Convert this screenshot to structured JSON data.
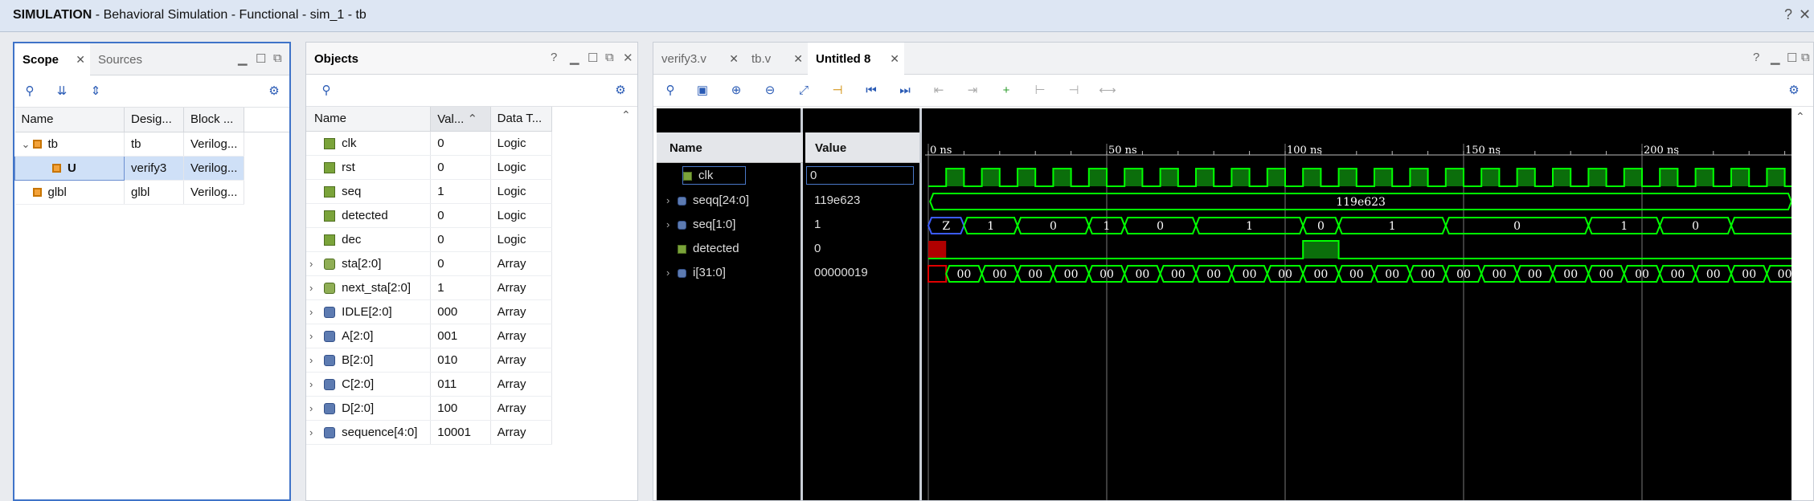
{
  "titlebar": {
    "app": "SIMULATION",
    "subtitle": " - Behavioral Simulation - Functional - sim_1 - tb",
    "help": "?",
    "close": "✕"
  },
  "scope": {
    "tabs": [
      "Scope",
      "Sources"
    ],
    "columns": [
      "Name",
      "Desig...",
      "Block ..."
    ],
    "rows": [
      {
        "name": "tb",
        "design": "tb",
        "block": "Verilog..."
      },
      {
        "name": "U",
        "design": "verify3",
        "block": "Verilog..."
      },
      {
        "name": "glbl",
        "design": "glbl",
        "block": "Verilog..."
      }
    ]
  },
  "objects": {
    "title": "Objects",
    "columns": [
      "Name",
      "Val...",
      "Data T..."
    ],
    "rows": [
      {
        "name": "clk",
        "value": "0",
        "type": "Logic",
        "icon": "logic",
        "expand": ""
      },
      {
        "name": "rst",
        "value": "0",
        "type": "Logic",
        "icon": "logic",
        "expand": ""
      },
      {
        "name": "seq",
        "value": "1",
        "type": "Logic",
        "icon": "logic",
        "expand": ""
      },
      {
        "name": "detected",
        "value": "0",
        "type": "Logic",
        "icon": "logic",
        "expand": ""
      },
      {
        "name": "dec",
        "value": "0",
        "type": "Logic",
        "icon": "logic",
        "expand": ""
      },
      {
        "name": "sta[2:0]",
        "value": "0",
        "type": "Array",
        "icon": "arrg",
        "expand": "›"
      },
      {
        "name": "next_sta[2:0]",
        "value": "1",
        "type": "Array",
        "icon": "arrg",
        "expand": "›"
      },
      {
        "name": "IDLE[2:0]",
        "value": "000",
        "type": "Array",
        "icon": "arr",
        "expand": "›"
      },
      {
        "name": "A[2:0]",
        "value": "001",
        "type": "Array",
        "icon": "arr",
        "expand": "›"
      },
      {
        "name": "B[2:0]",
        "value": "010",
        "type": "Array",
        "icon": "arr",
        "expand": "›"
      },
      {
        "name": "C[2:0]",
        "value": "011",
        "type": "Array",
        "icon": "arr",
        "expand": "›"
      },
      {
        "name": "D[2:0]",
        "value": "100",
        "type": "Array",
        "icon": "arr",
        "expand": "›"
      },
      {
        "name": "sequence[4:0]",
        "value": "10001",
        "type": "Array",
        "icon": "arr",
        "expand": "›"
      }
    ]
  },
  "editor": {
    "tabs": [
      "verify3.v",
      "tb.v",
      "Untitled 8"
    ],
    "active_tab": 2
  },
  "wave": {
    "header": {
      "name": "Name",
      "value": "Value"
    },
    "signals": [
      {
        "name": "clk",
        "value": "0",
        "expand": ""
      },
      {
        "name": "seqq[24:0]",
        "value": "119e623",
        "expand": "›"
      },
      {
        "name": "seq[1:0]",
        "value": "1",
        "expand": "›"
      },
      {
        "name": "detected",
        "value": "0",
        "expand": ""
      },
      {
        "name": "i[31:0]",
        "value": "00000019",
        "expand": "›"
      }
    ],
    "ruler": [
      "0 ns",
      "50 ns",
      "100 ns",
      "150 ns",
      "200 ns"
    ],
    "seqq_label": "119e623",
    "seq_labels": [
      "Z",
      "1",
      "0",
      "1",
      "0",
      "1",
      "0",
      "1",
      "0",
      "1",
      "0"
    ],
    "i_label": "00"
  },
  "colors": {
    "wave_green": "#00ff00",
    "wave_fill": "#0b6e0b",
    "accent_blue": "#2a5bb5"
  }
}
